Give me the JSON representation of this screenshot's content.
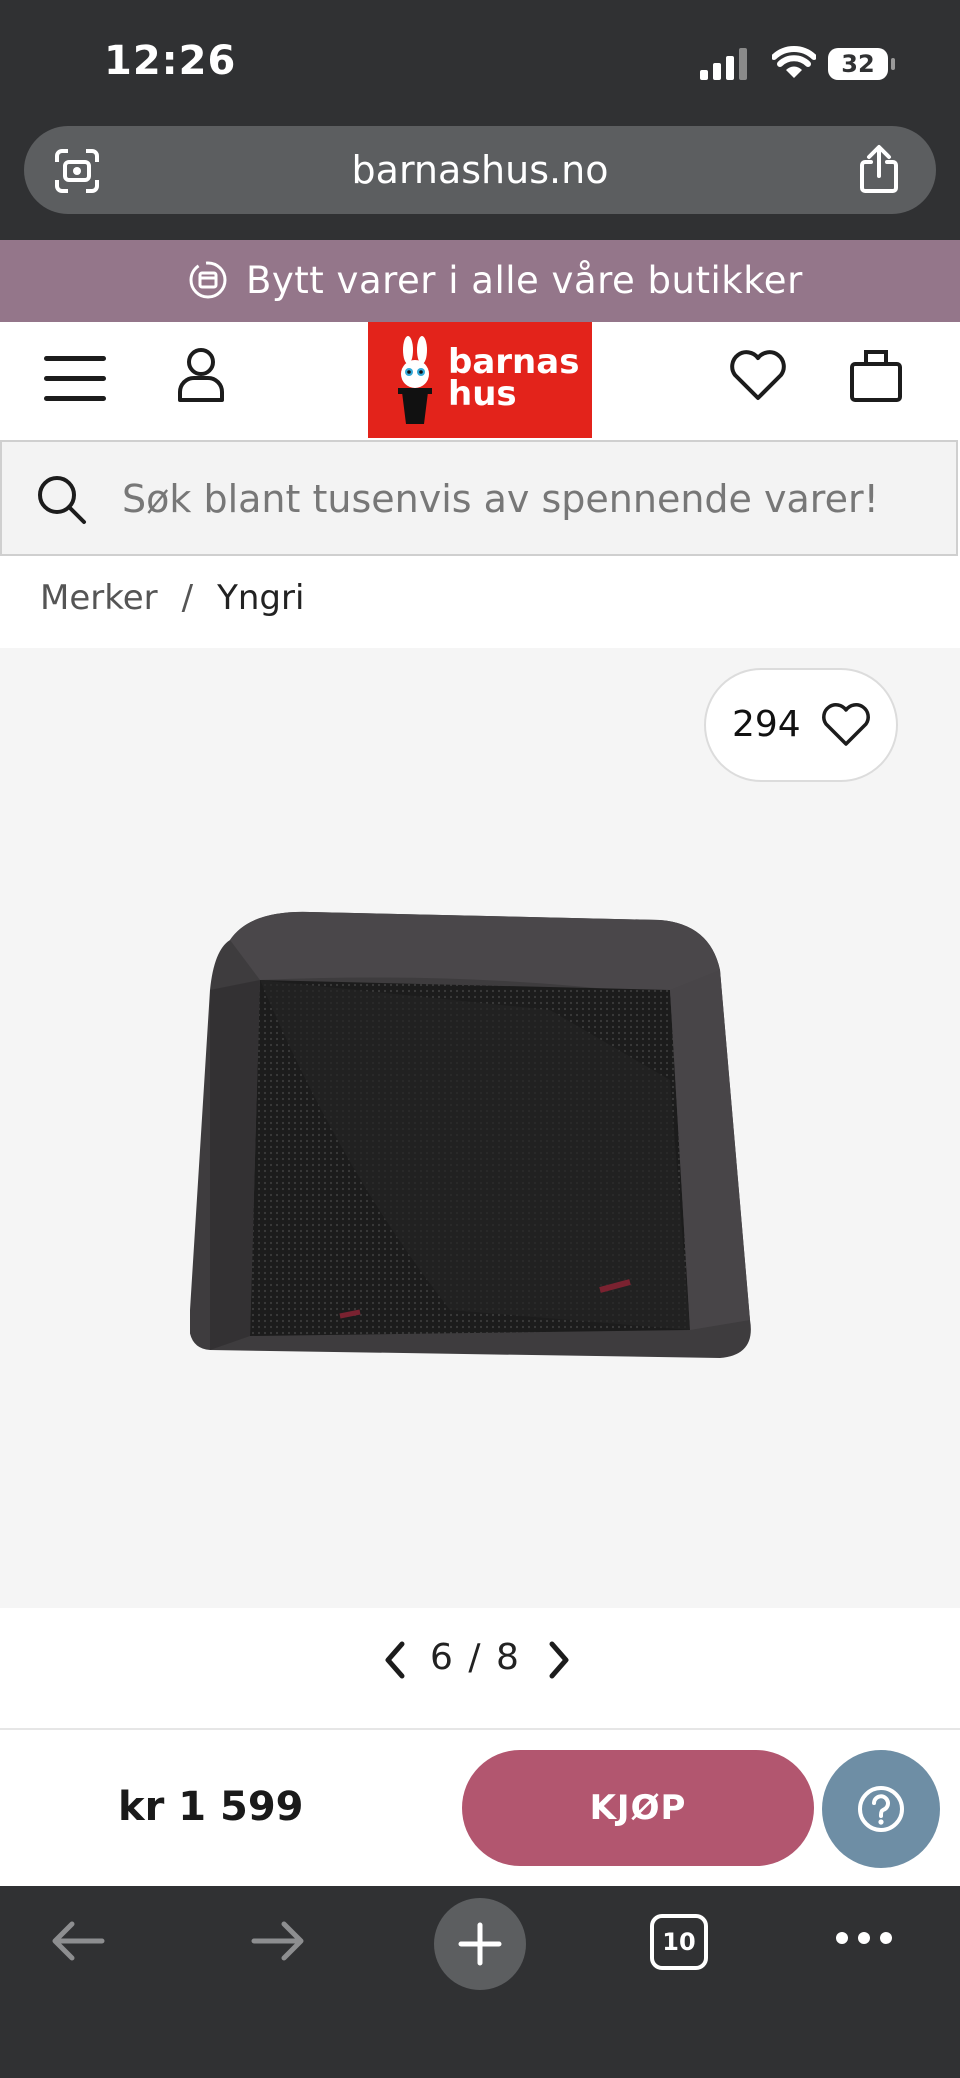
{
  "status_bar": {
    "time": "12:26",
    "battery": "32"
  },
  "browser": {
    "url": "barnashus.no",
    "tabs_count": "10"
  },
  "promo": {
    "text": "Bytt varer i alle våre butikker"
  },
  "header": {
    "logo_line1": "barnas",
    "logo_line2": "hus"
  },
  "search": {
    "placeholder": "Søk blant tusenvis av spennende varer!"
  },
  "breadcrumb": {
    "items": [
      "Merker",
      "Yngri"
    ],
    "separator": "/"
  },
  "product": {
    "likes": "294",
    "image_index": "6",
    "image_separator": "/",
    "image_total": "8",
    "price": "kr 1 599",
    "buy_label": "KJØP"
  },
  "colors": {
    "chrome": "#303133",
    "promo_bg": "#94768a",
    "logo_red": "#e3231b",
    "buy_button": "#b2566f",
    "help_button": "#6e8ea5"
  },
  "icons": [
    "lens-icon",
    "share-icon",
    "exchange-icon",
    "menu-icon",
    "account-icon",
    "heart-icon",
    "bag-icon",
    "search-icon",
    "chevron-left-icon",
    "chevron-right-icon",
    "help-icon",
    "back-icon",
    "forward-icon",
    "plus-icon",
    "tabs-icon",
    "more-icon"
  ]
}
